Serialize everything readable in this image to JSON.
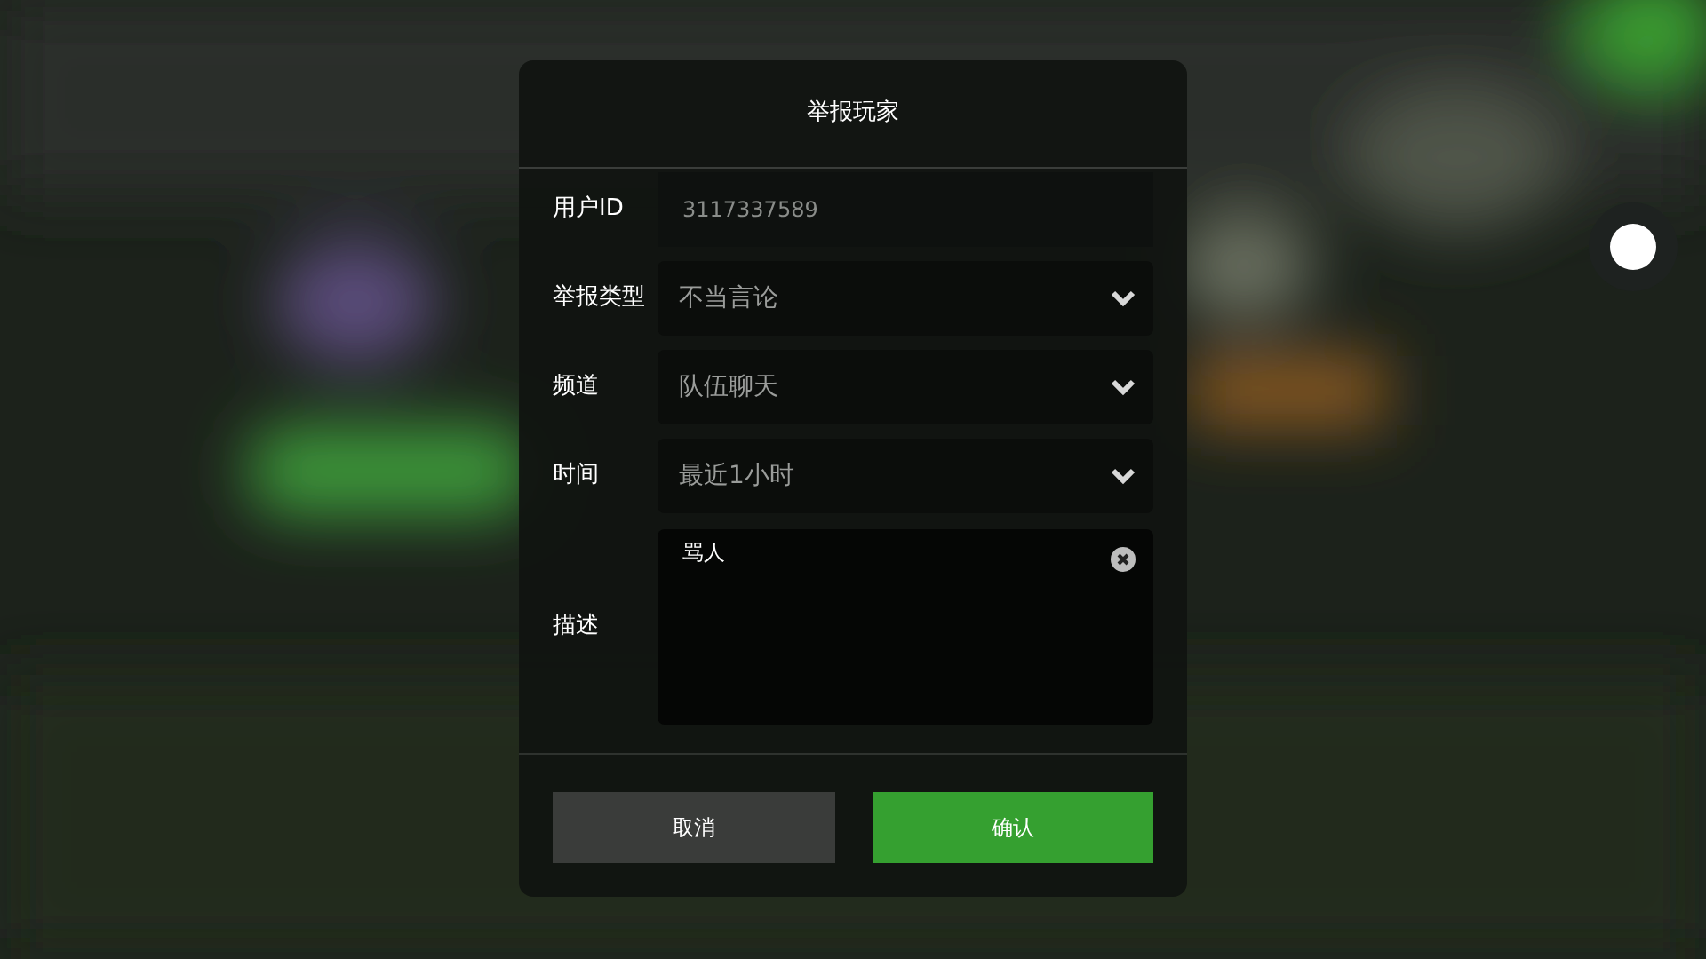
{
  "dialog": {
    "title": "举报玩家",
    "fields": [
      {
        "kind": "text",
        "label": "用户ID",
        "value": "3117337589"
      },
      {
        "kind": "select",
        "label": "举报类型",
        "value": "不当言论"
      },
      {
        "kind": "select",
        "label": "频道",
        "value": "队伍聊天"
      },
      {
        "kind": "select",
        "label": "时间",
        "value": "最近1小时"
      },
      {
        "kind": "textarea",
        "label": "描述",
        "value": "骂人"
      }
    ],
    "buttons": [
      {
        "kind": "secondary",
        "label": "取消"
      },
      {
        "kind": "primary",
        "label": "确认"
      }
    ]
  }
}
